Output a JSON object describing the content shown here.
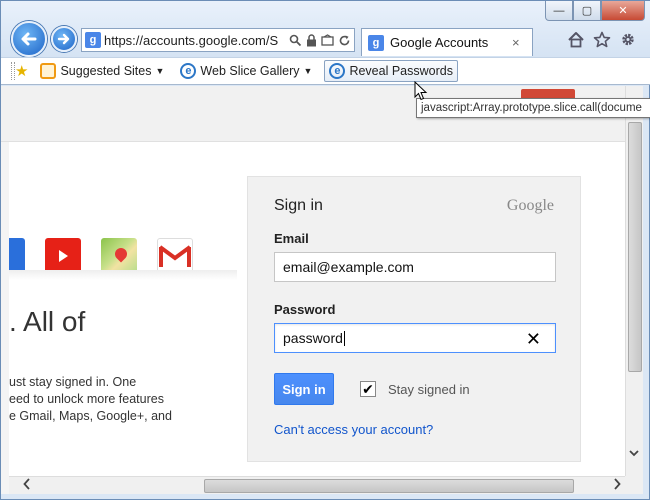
{
  "browser": {
    "url": "https://accounts.google.com/S",
    "tab_title": "Google Accounts",
    "tab_close": "×",
    "window_controls": {
      "minimize": "—",
      "maximize": "▢",
      "close": "✕"
    }
  },
  "favorites_bar": {
    "items": [
      {
        "label": "Suggested Sites",
        "dropdown": "▼"
      },
      {
        "label": "Web Slice Gallery",
        "dropdown": "▼"
      },
      {
        "label": "Reveal Passwords"
      }
    ]
  },
  "tooltip": {
    "text": "javascript:Array.prototype.slice.call(docume"
  },
  "page": {
    "headline_fragment": ". All of",
    "blurb_lines": [
      "ust stay signed in. One",
      "eed to unlock more features",
      "e Gmail, Maps, Google+, and"
    ]
  },
  "signin": {
    "title": "Sign in",
    "brand": "Google",
    "email_label": "Email",
    "email_value": "email@example.com",
    "password_label": "Password",
    "password_value": "password",
    "clear_icon": "✕",
    "submit_label": "Sign in",
    "stay_signed_in_label": "Stay signed in",
    "stay_signed_in_checked": true,
    "checkmark": "✔",
    "cant_access_link": "Can't access your account?"
  },
  "colors": {
    "signin_button": "#4d90fe",
    "link": "#1155cc",
    "youtube": "#e62117",
    "topbar_red": "#d14836"
  }
}
